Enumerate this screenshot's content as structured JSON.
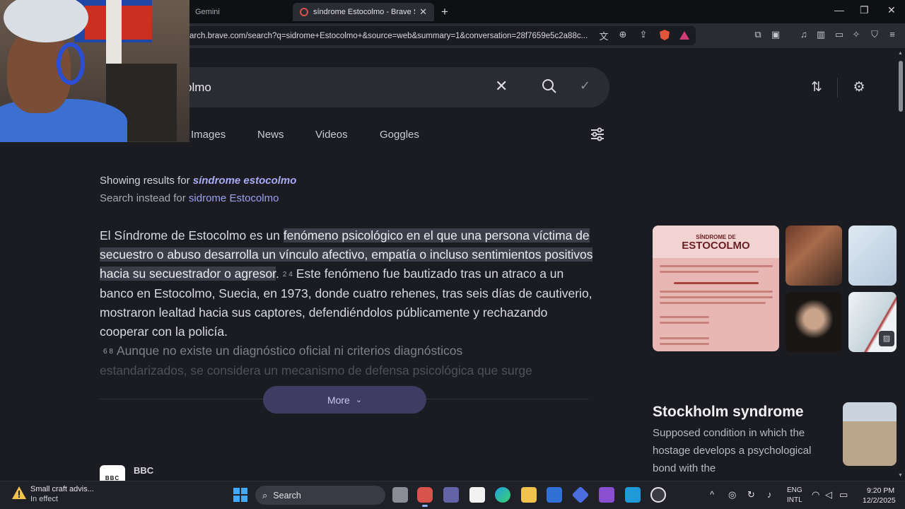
{
  "browser": {
    "tabs": [
      {
        "title": "Gemini",
        "active": false
      },
      {
        "title": "síndrome Estocolmo - Brave Search",
        "active": true
      }
    ],
    "url": "arch.brave.com/search?q=sidrome+Estocolmo+&source=web&summary=1&conversation=28f7659e5c2a88c..."
  },
  "search": {
    "query_visible": "olmo",
    "nav_tabs": [
      "Images",
      "News",
      "Videos",
      "Goggles"
    ]
  },
  "spellcheck": {
    "showing_prefix": "Showing results for",
    "showing_query": "síndrome estocolmo",
    "instead_prefix": "Search instead for",
    "instead_query": "sidrome Estocolmo"
  },
  "summary": {
    "intro": "El Síndrome de Estocolmo es un ",
    "highlighted": "fenómeno psicológico en el que una persona víctima de secuestro o abuso desarrolla un vínculo afectivo, empatía o incluso sentimientos positivos hacia su secuestrador o agresor",
    "after_highlight": ".",
    "cite_a": "2 4",
    "sentence2": "Este fenómeno fue bautizado tras un atraco a un banco en Estocolmo, Suecia, en 1973, donde cuatro rehenes, tras seis días de cautiverio, mostraron lealtad hacia sus captores, defendiéndolos públicamente y rechazando cooperar con la policía.",
    "cite_b": "6 8",
    "sentence3a": "Aunque no existe un diagnóstico oficial ni criterios diagnósticos",
    "sentence3b": "estandarizados, se considera un mecanismo de defensa psicológica que surge",
    "more_label": "More"
  },
  "results": [
    {
      "source": "BBC",
      "logo_text": "BBC"
    }
  ],
  "images": {
    "main_heading_small": "SÍNDROME DE",
    "main_heading_big": "ESTOCOLMO"
  },
  "knowledge_panel": {
    "title": "Stockholm syndrome",
    "description": "Supposed condition in which the hostage develops a psychological bond with the"
  },
  "taskbar": {
    "weather_line1": "Small craft advis...",
    "weather_line2": "In effect",
    "search_label": "Search",
    "lang_line1": "ENG",
    "lang_line2": "INTL",
    "time": "9:20 PM",
    "date": "12/2/2025"
  },
  "colors": {
    "page_bg": "#1b1c22",
    "accent": "#a9aaf4",
    "more_button": "#3e3c63"
  }
}
